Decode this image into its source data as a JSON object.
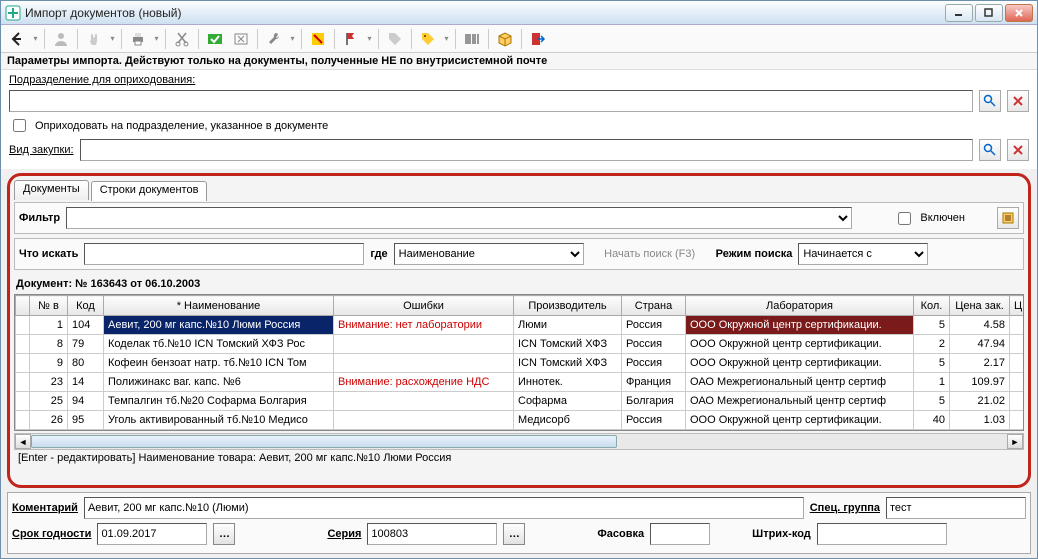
{
  "window": {
    "title": "Импорт документов (новый)"
  },
  "params_header": "Параметры импорта. Действуют только на документы, полученные НЕ по внутрисистемной почте",
  "form": {
    "division_label": "Подразделение для оприходования:",
    "division_value": "",
    "option_label": "Оприходовать на подразделение, указанное в документе",
    "purchase_type_label": "Вид закупки:",
    "purchase_type_value": ""
  },
  "tabs": {
    "t0": "Документы",
    "t1": "Строки документов"
  },
  "filter": {
    "label": "Фильтр",
    "value": "",
    "enabled_label": "Включен"
  },
  "search": {
    "what_label": "Что искать",
    "what_value": "",
    "where_label": "где",
    "where_value": "Наименование",
    "start_label": "Начать поиск (F3)",
    "mode_label": "Режим поиска",
    "mode_value": "Начинается с"
  },
  "doc_header": "Документ: № 163643 от 06.10.2003",
  "columns": {
    "c0": "№ в",
    "c1": "Код",
    "c2": "* Наименование",
    "c3": "Ошибки",
    "c4": "Производитель",
    "c5": "Страна",
    "c6": "Лаборатория",
    "c7": "Кол.",
    "c8": "Цена зак.",
    "c9": "Ц"
  },
  "rows": [
    {
      "n": "1",
      "code": "104",
      "name": "Аевит, 200 мг капс.№10 Люми Россия",
      "err": "Внимание: нет лаборатории",
      "prod": "Люми",
      "country": "Россия",
      "lab": "ООО Окружной центр сертификации.",
      "qty": "5",
      "price": "4.58",
      "sel": true,
      "labsel": true
    },
    {
      "n": "8",
      "code": "79",
      "name": "Коделак тб.№10 ICN Томский ХФЗ Рос",
      "err": "",
      "prod": "ICN Томский ХФЗ",
      "country": "Россия",
      "lab": "ООО Окружной центр сертификации.",
      "qty": "2",
      "price": "47.94"
    },
    {
      "n": "9",
      "code": "80",
      "name": "Кофеин бензоат натр. тб.№10 ICN Том",
      "err": "",
      "prod": "ICN Томский ХФЗ",
      "country": "Россия",
      "lab": "ООО Окружной центр сертификации.",
      "qty": "5",
      "price": "2.17"
    },
    {
      "n": "23",
      "code": "14",
      "name": "Полижинакс ваг. капс. №6",
      "err": "Внимание: расхождение НДС",
      "prod": "Иннотек.",
      "country": "Франция",
      "lab": "ОАО Межрегиональный центр сертиф",
      "qty": "1",
      "price": "109.97"
    },
    {
      "n": "25",
      "code": "94",
      "name": "Темпалгин тб.№20 Софарма Болгария",
      "err": "",
      "prod": "Софарма",
      "country": "Болгария",
      "lab": "ОАО Межрегиональный центр сертиф",
      "qty": "5",
      "price": "21.02"
    },
    {
      "n": "26",
      "code": "95",
      "name": "Уголь активированный тб.№10 Медисо",
      "err": "",
      "prod": "Медисорб",
      "country": "Россия",
      "lab": "ООО Окружной центр сертификации.",
      "qty": "40",
      "price": "1.03"
    }
  ],
  "status_line": "[Enter - редактировать] Наименование товара: Аевит, 200 мг капс.№10 Люми Россия",
  "bottom": {
    "comment_label": "Коментарий",
    "comment_value": "Аевит, 200 мг капс.№10 (Люми)",
    "spec_group_label": "Спец. группа",
    "spec_group_value": "тест",
    "expiry_label": "Срок годности",
    "expiry_value": "01.09.2017",
    "series_label": "Серия",
    "series_value": "100803",
    "packing_label": "Фасовка",
    "packing_value": "",
    "barcode_label": "Штрих-код",
    "barcode_value": ""
  }
}
